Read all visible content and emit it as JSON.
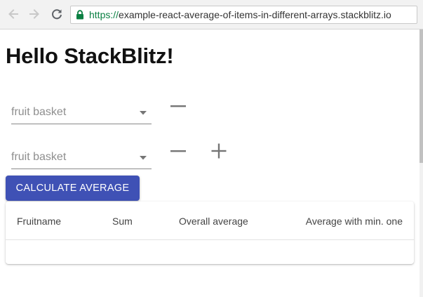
{
  "browser": {
    "url_scheme": "https://",
    "url_rest": "example-react-average-of-items-in-different-arrays.stackblitz.io"
  },
  "page": {
    "title": "Hello StackBlitz!"
  },
  "selects": [
    {
      "placeholder": "fruit basket"
    },
    {
      "placeholder": "fruit basket"
    }
  ],
  "actions": {
    "calculate_label": "Calculate average"
  },
  "table": {
    "columns": [
      "Fruitname",
      "Sum",
      "Overall average",
      "Average with min. one"
    ],
    "rows": []
  },
  "icons": {
    "back": "arrow-left-icon",
    "forward": "arrow-right-icon",
    "reload": "reload-icon",
    "secure": "lock-icon",
    "remove": "minus-icon",
    "add": "plus-icon",
    "dropdown": "caret-down-icon"
  },
  "colors": {
    "primary": "#3f51b5",
    "secure_green": "#0b8043",
    "icon_gray": "#757575"
  }
}
